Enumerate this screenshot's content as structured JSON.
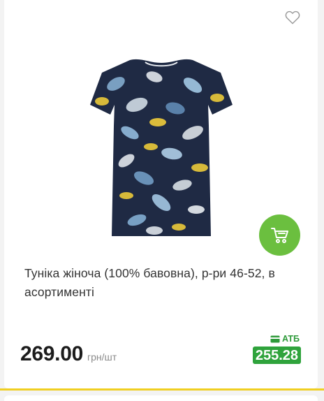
{
  "product": {
    "title": "Туніка жіноча (100% бавовна), р-ри 46-52, в асортименті",
    "price": "269.00",
    "unit": "грн/шт",
    "atb_label": "АТБ",
    "atb_price": "255.28",
    "image_alt": "tunic-floral-print"
  },
  "icons": {
    "favorite": "heart-outline-icon",
    "cart": "shopping-cart-icon",
    "card": "credit-card-icon"
  },
  "colors": {
    "accent_green": "#6bbf3f",
    "atb_green": "#2fa33c",
    "divider_yellow": "#f0cf22"
  }
}
